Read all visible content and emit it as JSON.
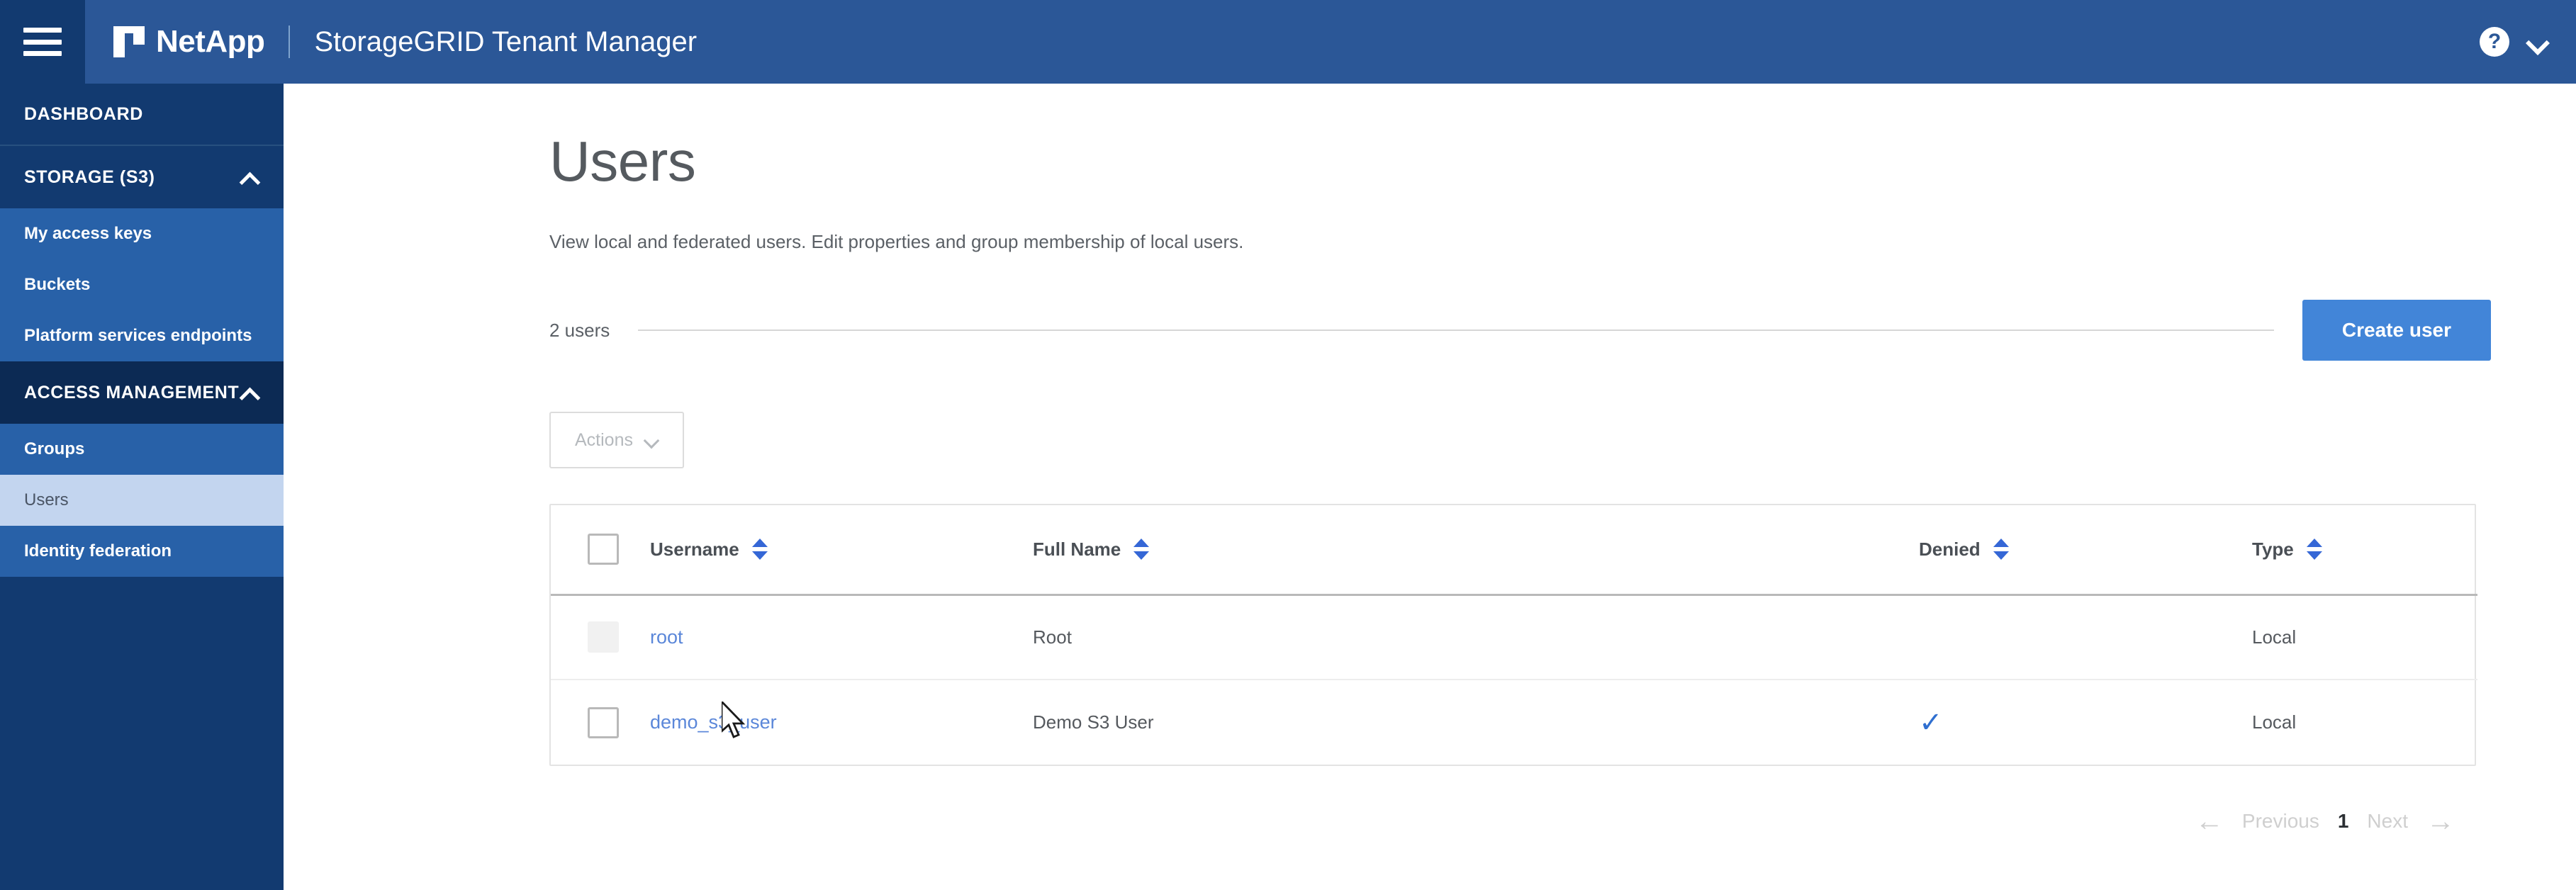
{
  "topbar": {
    "menu_icon": "hamburger-icon",
    "brand": "NetApp",
    "app_title": "StorageGRID Tenant Manager",
    "help_icon": "?",
    "account_chevron": "chevron-down-icon",
    "bg_color": "#2b5797",
    "menu_bg_color": "#123a70"
  },
  "sidebar": {
    "bg_color": "#123a70",
    "active_bg_color": "#c3d5ef",
    "sections": [
      {
        "label": "DASHBOARD",
        "type": "link",
        "expanded": false,
        "items": []
      },
      {
        "label": "STORAGE (S3)",
        "type": "group",
        "expanded": true,
        "chevron": "chevron-up-icon",
        "items": [
          {
            "label": "My access keys",
            "active": false
          },
          {
            "label": "Buckets",
            "active": false
          },
          {
            "label": "Platform services endpoints",
            "active": false
          }
        ]
      },
      {
        "label": "ACCESS MANAGEMENT",
        "type": "group",
        "expanded": true,
        "chevron": "chevron-up-icon",
        "items": [
          {
            "label": "Groups",
            "active": false
          },
          {
            "label": "Users",
            "active": true
          },
          {
            "label": "Identity federation",
            "active": false
          }
        ]
      }
    ]
  },
  "page": {
    "title": "Users",
    "description": "View local and federated users. Edit properties and group membership of local users.",
    "count_label": "2 users",
    "create_button": "Create user",
    "create_button_color": "#4285d8",
    "actions_button": "Actions",
    "actions_disabled": true
  },
  "table": {
    "columns": [
      {
        "key": "checkbox",
        "label": "",
        "sortable": false
      },
      {
        "key": "username",
        "label": "Username",
        "sortable": true
      },
      {
        "key": "fullname",
        "label": "Full Name",
        "sortable": true
      },
      {
        "key": "denied",
        "label": "Denied",
        "sortable": true
      },
      {
        "key": "type",
        "label": "Type",
        "sortable": true
      }
    ],
    "rows": [
      {
        "username": "root",
        "fullname": "Root",
        "denied": "",
        "type": "Local",
        "checkbox_disabled": true
      },
      {
        "username": "demo_s3_user",
        "fullname": "Demo S3 User",
        "denied": "✓",
        "type": "Local",
        "checkbox_disabled": false
      }
    ],
    "link_color": "#5b87d9",
    "sort_icon_color": "#3567d6",
    "denied_check_color": "#2f6fd0"
  },
  "pagination": {
    "previous_label": "Previous",
    "previous_icon": "arrow-left-icon",
    "next_label": "Next",
    "next_icon": "arrow-right-icon",
    "current_page": "1",
    "previous_disabled": true,
    "next_disabled": true
  }
}
